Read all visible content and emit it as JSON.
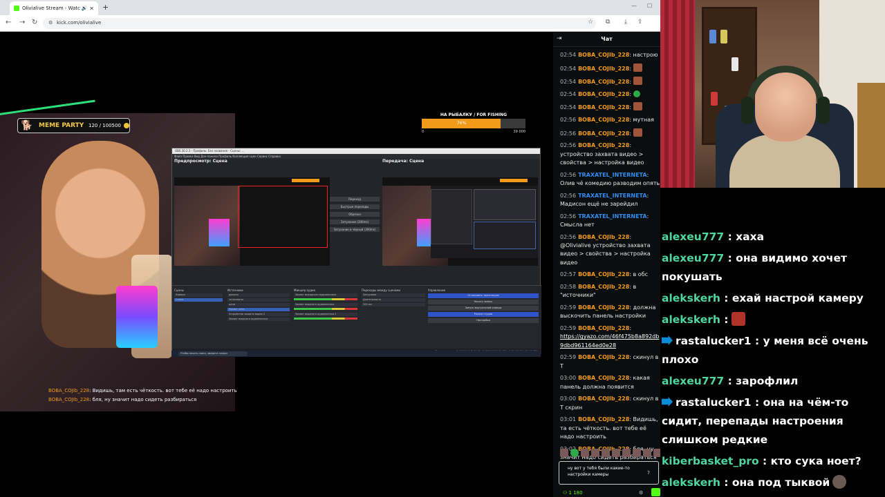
{
  "browser": {
    "tab_title": "Olivialive Stream - Watch Li...",
    "url": "kick.com/olivialive",
    "new_tab": "+",
    "avatar_letter": "G"
  },
  "video": {
    "meme_party": "MEME PARTY",
    "meme_count": "120 / 100500",
    "goal_title": "НА РЫБАЛКУ / FOR FISHING",
    "goal_percent_label": "76%",
    "goal_progress": 0.76,
    "goal_min": "0",
    "goal_max": "39 000",
    "overlay_chat": [
      {
        "user": "BOBA_COJIb_228",
        "text": ": Видишь, там есть чёткость. вот тебе её надо настроить"
      },
      {
        "user": "BOBA_COJIb_228",
        "text": ": бля, ну значит надо сидеть разбираться"
      }
    ],
    "obs": {
      "title": "OBS 30.2.3 - Профиль: Без названия - Сцены: ...",
      "menu": "Файл  Правка  Вид  Док-панели  Профиль  Коллекция сцен  Сервис  Справка",
      "preview_label": "Предпросмотр: Сцена",
      "program_label": "Передача: Сцена",
      "transitions": [
        "Переход",
        "Быстрые переходы",
        "Обрезка",
        "Затухание (300ms)",
        "Затухание в чёрный (300ms)"
      ],
      "scenes_header": "Сцены",
      "scenes": [
        "Камера",
        "Сцена"
      ],
      "sources_header": "Источники",
      "sources": [
        "донаты",
        "чат/алерты",
        "цели",
        "Захват окна",
        "Устройство захвата видео 2",
        "Захват входного аудиопотока"
      ],
      "mixer_header": "Микшер аудио",
      "mixer": [
        "Захват выходного аудиопотока",
        "Захват входного аудиопотока",
        "Захват входного аудиопотока 2"
      ],
      "transitions_header": "Переходы между сценами",
      "transition_value": "Затухание",
      "duration_label": "Длительность",
      "duration_value": "300 ms",
      "controls_header": "Управление",
      "controls": [
        "Остановить трансляцию",
        "Начать запись",
        "Запуск виртуальной камеры",
        "Режим студии",
        "Настройки"
      ],
      "status": "Пропуск кадров 0 (0.0%)   LIVE 01:03:44   REC 00:00:00   CPU: 5.0%   60.00 / 60.00 FPS",
      "taskbar_search": "Чтобы начать поиск, введите запрос"
    }
  },
  "chat": {
    "title": "Чат",
    "messages": [
      {
        "time": "02:54",
        "user": "BOBA_COJIb_228",
        "color": "#f29a1a",
        "text": ": настрою"
      },
      {
        "time": "02:54",
        "user": "BOBA_COJIb_228",
        "color": "#f29a1a",
        "text": ":",
        "emote": "face"
      },
      {
        "time": "02:54",
        "user": "BOBA_COJIb_228",
        "color": "#f29a1a",
        "text": ":",
        "emote": "face"
      },
      {
        "time": "02:54",
        "user": "BOBA_COJIb_228",
        "color": "#f29a1a",
        "text": ":",
        "emote": "green"
      },
      {
        "time": "02:54",
        "user": "BOBA_COJIb_228",
        "color": "#f29a1a",
        "text": ":",
        "emote": "face"
      },
      {
        "time": "02:56",
        "user": "BOBA_COJIb_228",
        "color": "#f29a1a",
        "text": ": мутная"
      },
      {
        "time": "02:56",
        "user": "BOBA_COJIb_228",
        "color": "#f29a1a",
        "text": ":",
        "emote": "face"
      },
      {
        "time": "02:56",
        "user": "BOBA_COJIb_228",
        "color": "#f29a1a",
        "text": ": устройство захвата видео > свойства > настройка видео"
      },
      {
        "time": "02:56",
        "user": "TRAXATEL_INTERNETA",
        "color": "#2f8cf0",
        "text": ": Олив чё комедию разводим опять"
      },
      {
        "time": "02:56",
        "user": "TRAXATEL_INTERNETA",
        "color": "#2f8cf0",
        "text": ": Мадисон ещё не зарейдил"
      },
      {
        "time": "02:56",
        "user": "TRAXATEL_INTERNETA",
        "color": "#2f8cf0",
        "text": ": Смысла нет"
      },
      {
        "time": "02:56",
        "user": "BOBA_COJIb_228",
        "color": "#f29a1a",
        "text": ": @Olivialive устройство захвата видео > свойства > настройка видео"
      },
      {
        "time": "02:57",
        "user": "BOBA_COJIb_228",
        "color": "#f29a1a",
        "text": ": в обс"
      },
      {
        "time": "02:58",
        "user": "BOBA_COJIb_228",
        "color": "#f29a1a",
        "text": ": в \"источники\""
      },
      {
        "time": "02:59",
        "user": "BOBA_COJIb_228",
        "color": "#f29a1a",
        "text": ": должна выскочить панель настройки"
      },
      {
        "time": "02:59",
        "user": "BOBA_COJIb_228",
        "color": "#f29a1a",
        "text": ":",
        "link": "https://gyazo.com/46f475b8a892db9dbd961164ed0e28"
      },
      {
        "time": "02:59",
        "user": "BOBA_COJIb_228",
        "color": "#f29a1a",
        "text": ": скинул в Т"
      },
      {
        "time": "03:00",
        "user": "BOBA_COJIb_228",
        "color": "#f29a1a",
        "text": ": какая панель должна появится"
      },
      {
        "time": "03:00",
        "user": "BOBA_COJIb_228",
        "color": "#f29a1a",
        "text": ": скинул в Т скрин"
      },
      {
        "time": "03:01",
        "user": "BOBA_COJIb_228",
        "color": "#f29a1a",
        "text": ": Видишь, та есть чёткость. вот тебе её надо настроить"
      },
      {
        "time": "03:02",
        "user": "BOBA_COJIb_228",
        "color": "#f29a1a",
        "text": ": бля, ну значит надо сидеть разбираться"
      }
    ],
    "input_text": "ну вот у тебя были какие-то настройки камеры",
    "input_counter": "7",
    "viewers": "1 180"
  },
  "bigchat": [
    {
      "user": "alexeu777",
      "text": " : хаха"
    },
    {
      "user": "alexeu777",
      "text": " : она видимо хочет покушать"
    },
    {
      "user": "alekskerh",
      "text": " : ехай настрой камеру"
    },
    {
      "user": "alekskerh",
      "text": " :",
      "emote": "red"
    },
    {
      "user": "rastalucker1",
      "prime": true,
      "text": " : у меня всё очень плохо"
    },
    {
      "user": "alexeu777",
      "text": " : зарофлил"
    },
    {
      "user": "rastalucker1",
      "prime": true,
      "text": " : она на чём-то сидит, перепады настроения слишком редкие"
    },
    {
      "user": "kiberbasket_pro",
      "text": " : кто сука ноет?"
    },
    {
      "user": "alekskerh",
      "text": " : она под тыквой",
      "emote": "grey"
    }
  ]
}
